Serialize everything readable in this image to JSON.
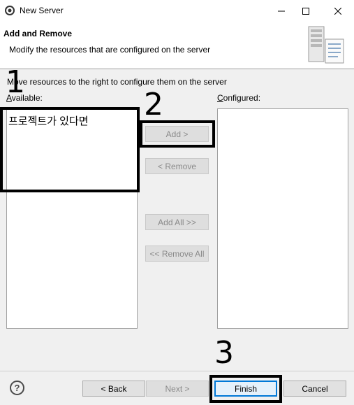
{
  "window": {
    "title": "New Server"
  },
  "header": {
    "title": "Add and Remove",
    "description": "Modify the resources that are configured on the server"
  },
  "main": {
    "instruction": "Move resources to the right to configure them on the server",
    "available_label": "Available:",
    "configured_label": "Configured:",
    "available_items": [
      "프로젝트가 있다면"
    ],
    "configured_items": [],
    "buttons": {
      "add": "Add >",
      "remove": "< Remove",
      "add_all": "Add All >>",
      "remove_all": "<< Remove All"
    }
  },
  "footer": {
    "back": "< Back",
    "next": "Next >",
    "finish": "Finish",
    "cancel": "Cancel",
    "help": "?"
  },
  "annotations": [
    "1",
    "2",
    "3"
  ],
  "colors": {
    "focus_border": "#0078d7",
    "annotation": "#000000"
  }
}
